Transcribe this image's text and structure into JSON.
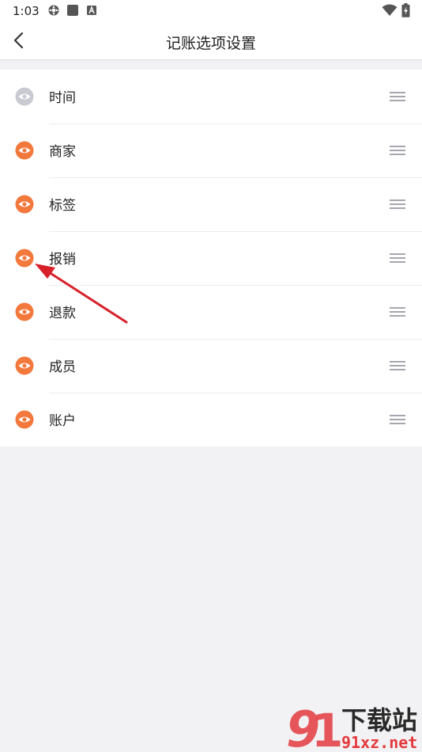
{
  "status_bar": {
    "time": "1:03"
  },
  "header": {
    "title": "记账选项设置"
  },
  "options": [
    {
      "label": "时间",
      "visible": false
    },
    {
      "label": "商家",
      "visible": true
    },
    {
      "label": "标签",
      "visible": true
    },
    {
      "label": "报销",
      "visible": true
    },
    {
      "label": "退款",
      "visible": true
    },
    {
      "label": "成员",
      "visible": true
    },
    {
      "label": "账户",
      "visible": true
    }
  ],
  "colors": {
    "accent": "#f2783c",
    "disabled_eye": "#c9cbd2",
    "arrow": "#d8202a",
    "watermark_red": "#e33a3e"
  },
  "watermark": {
    "brand": "下载站",
    "domain": "91xz.net"
  }
}
